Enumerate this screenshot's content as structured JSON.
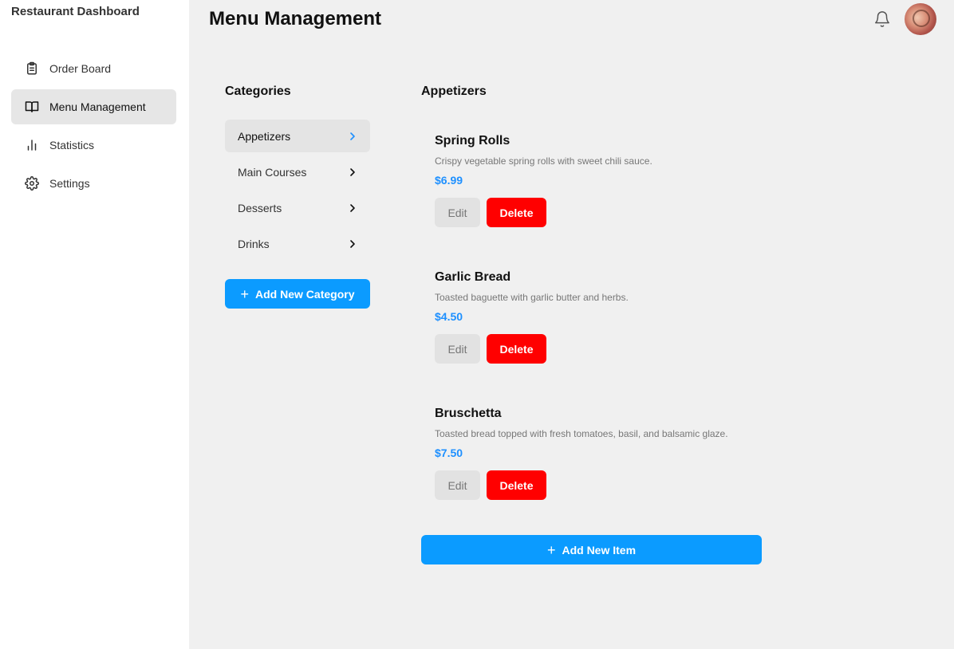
{
  "sidebar": {
    "brand": "Restaurant Dashboard",
    "items": [
      {
        "label": "Order Board",
        "icon": "clipboard-icon"
      },
      {
        "label": "Menu Management",
        "icon": "book-icon",
        "active": true
      },
      {
        "label": "Statistics",
        "icon": "bar-chart-icon"
      },
      {
        "label": "Settings",
        "icon": "gear-icon"
      }
    ]
  },
  "header": {
    "title": "Menu Management",
    "icons": [
      "bell-icon",
      "avatar"
    ]
  },
  "categories": {
    "heading": "Categories",
    "items": [
      {
        "label": "Appetizers",
        "active": true
      },
      {
        "label": "Main Courses"
      },
      {
        "label": "Desserts"
      },
      {
        "label": "Drinks"
      }
    ],
    "add_label": "Add New Category"
  },
  "menu": {
    "heading": "Appetizers",
    "items": [
      {
        "name": "Spring Rolls",
        "description": "Crispy vegetable spring rolls with sweet chili sauce.",
        "price": "$6.99",
        "edit_label": "Edit",
        "delete_label": "Delete"
      },
      {
        "name": "Garlic Bread",
        "description": "Toasted baguette with garlic butter and herbs.",
        "price": "$4.50",
        "edit_label": "Edit",
        "delete_label": "Delete"
      },
      {
        "name": "Bruschetta",
        "description": "Toasted bread topped with fresh tomatoes, basil, and balsamic glaze.",
        "price": "$7.50",
        "edit_label": "Edit",
        "delete_label": "Delete"
      }
    ],
    "add_label": "Add New Item"
  },
  "colors": {
    "accent": "#0b9bff",
    "danger": "#ff0000",
    "price": "#1e90ff",
    "main_bg": "#f0f0f0"
  }
}
